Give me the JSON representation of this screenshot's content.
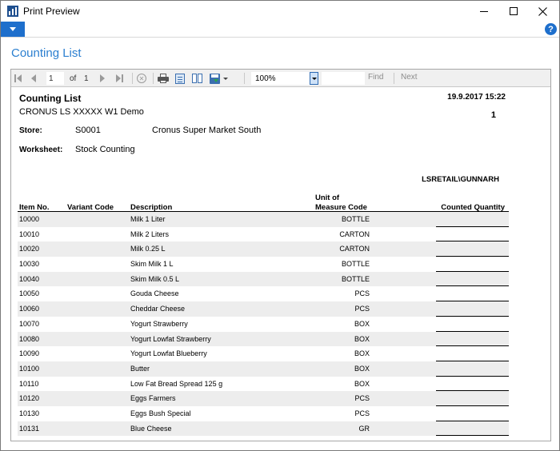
{
  "window": {
    "title": "Print Preview"
  },
  "page_title": "Counting List",
  "toolbar": {
    "current_page": "1",
    "of_label": "of",
    "total_pages": "1",
    "zoom": "100%",
    "find_label": "Find",
    "next_label": "Next"
  },
  "report": {
    "title": "Counting List",
    "datetime": "19.9.2017 15:22",
    "company": "CRONUS LS XXXXX W1 Demo",
    "page_number": "1",
    "store_label": "Store:",
    "store_code": "S0001",
    "store_name": "Cronus Super Market South",
    "worksheet_label": "Worksheet:",
    "worksheet_name": "Stock Counting",
    "user": "LSRETAIL\\GUNNARH",
    "columns": {
      "item_no": "Item No.",
      "variant_code": "Variant Code",
      "description": "Description",
      "uom_line1": "Unit of",
      "uom_line2": "Measure Code",
      "counted_quantity": "Counted Quantity"
    },
    "rows": [
      {
        "item_no": "10000",
        "description": "Milk 1 Liter",
        "uom": "BOTTLE"
      },
      {
        "item_no": "10010",
        "description": "Milk 2 Liters",
        "uom": "CARTON"
      },
      {
        "item_no": "10020",
        "description": "Milk 0.25 L",
        "uom": "CARTON"
      },
      {
        "item_no": "10030",
        "description": "Skim Milk 1 L",
        "uom": "BOTTLE"
      },
      {
        "item_no": "10040",
        "description": "Skim Milk 0.5 L",
        "uom": "BOTTLE"
      },
      {
        "item_no": "10050",
        "description": "Gouda Cheese",
        "uom": "PCS"
      },
      {
        "item_no": "10060",
        "description": "Cheddar Cheese",
        "uom": "PCS"
      },
      {
        "item_no": "10070",
        "description": "Yogurt Strawberry",
        "uom": "BOX"
      },
      {
        "item_no": "10080",
        "description": "Yogurt Lowfat Strawberry",
        "uom": "BOX"
      },
      {
        "item_no": "10090",
        "description": "Yogurt Lowfat Blueberry",
        "uom": "BOX"
      },
      {
        "item_no": "10100",
        "description": "Butter",
        "uom": "BOX"
      },
      {
        "item_no": "10110",
        "description": "Low Fat Bread Spread 125 g",
        "uom": "BOX"
      },
      {
        "item_no": "10120",
        "description": "Eggs Farmers",
        "uom": "PCS"
      },
      {
        "item_no": "10130",
        "description": "Eggs Bush Special",
        "uom": "PCS"
      },
      {
        "item_no": "10131",
        "description": "Blue Cheese",
        "uom": "GR"
      }
    ]
  },
  "colors": {
    "accent": "#1e6fcc",
    "page_title": "#2b7fd0",
    "row_shade": "#ededed"
  }
}
